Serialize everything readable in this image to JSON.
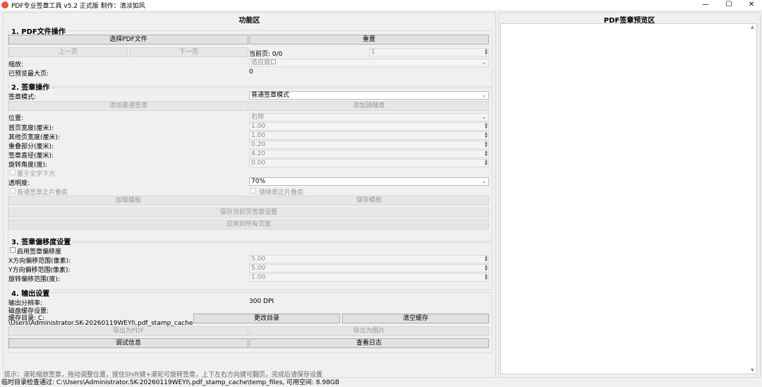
{
  "window": {
    "title": "PDF专业签章工具 v5.2 正式版    制作：清淡如风",
    "minimize_icon": "—",
    "maximize_icon": "☐",
    "close_icon": "✕"
  },
  "left_panel": {
    "title": "功能区"
  },
  "right_panel": {
    "title": "PDF签章预览区"
  },
  "s1": {
    "title": "1. PDF文件操作",
    "select_btn": "选择PDF文件",
    "reset_btn": "重置",
    "prev_btn": "上一页",
    "next_btn": "下一页",
    "cur_page_label": "当前页: 0/0",
    "page_value": "1",
    "zoom_label": "缩放:",
    "zoom_value": "适应窗口",
    "max_page_label": "已预览最大页:",
    "max_page_value": "0"
  },
  "s2": {
    "title": "2. 签章操作",
    "mode_label": "签章模式:",
    "mode_value": "普通签章模式",
    "add_normal_btn": "添加普通签章",
    "add_seam_btn": "添加骑缝章",
    "pos_label": "位置:",
    "pos_value": "右侧",
    "first_width_label": "首页宽度(厘米):",
    "first_width_value": "1.00",
    "other_width_label": "其他页宽度(厘米):",
    "other_width_value": "1.00",
    "overlap_label": "重叠部分(厘米):",
    "overlap_value": "0.20",
    "diameter_label": "签章直径(厘米):",
    "diameter_value": "4.20",
    "rotation_label": "旋转角度(度):",
    "rotation_value": "0.00",
    "under_text_label": "置于文字下方",
    "opacity_label": "透明度:",
    "opacity_value": "70%",
    "normal_stack_label": "普通签章正片叠底",
    "seam_stack_label": "骑缝章正片叠底",
    "load_tpl_btn": "加载模板",
    "save_tpl_btn": "保存模板",
    "save_page_btn": "保存当前页签章设置",
    "apply_all_btn": "应用到所有页面"
  },
  "s3": {
    "title": "3. 签章偏移度设置",
    "enable_label": "启用签章偏移度",
    "x_label": "X方向偏移范围(像素):",
    "x_value": "5.00",
    "y_label": "Y方向偏移范围(像素):",
    "y_value": "5.00",
    "rot_label": "旋转偏移范围(度):",
    "rot_value": "1.00"
  },
  "s4": {
    "title": "4. 输出设置",
    "dpi_label": "输出分辨率:",
    "dpi_value": "300 DPI",
    "cache_label": "磁盘缓存设置:",
    "cache_dir_1": "缓存目录: C:",
    "cache_dir_2": "\\Users\\Administrator.SK-20260119WEYI\\.pdf_stamp_cache",
    "change_dir_btn": "更改目录",
    "clear_cache_btn": "清空缓存",
    "export_pdf_btn": "导出为PDF",
    "export_img_btn": "导出为图片",
    "debug_btn": "调试信息",
    "log_btn": "查看日志"
  },
  "hint": "提示：滚轮缩放签章，拖动调整位置，按住Shift键+滚轮可旋转签章，上下左右方向键可翻页，完成后请保存设置",
  "status": "临时目录检查通过: C:\\Users\\Administrator.SK-20260119WEYI\\.pdf_stamp_cache\\temp_files, 可用空间: 8.98GB"
}
